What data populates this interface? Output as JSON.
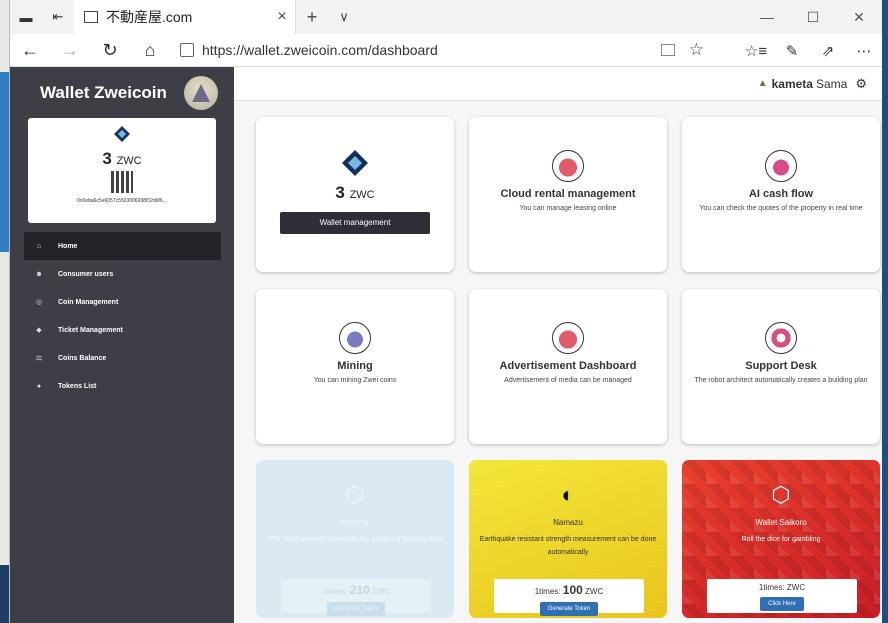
{
  "browser": {
    "tab_title": "不動産屋.com",
    "tab_close": "×",
    "new_tab": "+",
    "tab_list": "∨",
    "url": "https://wallet.zweicoin.com/dashboard",
    "back": "←",
    "forward": "→",
    "refresh": "↻",
    "home": "⌂",
    "favorite": "☆",
    "favorites_bar": "☆≡",
    "notes": "✎",
    "share": "⇗",
    "more": "⋯",
    "minimize": "—",
    "maximize": "☐",
    "close": "✕"
  },
  "sidebar": {
    "title": "Wallet Zweicoin",
    "wallet": {
      "amount": "3",
      "unit": "ZWC",
      "address": "0x0eba6c5e6057c5503006938f32d6f6..."
    },
    "items": [
      {
        "icon": "⌂",
        "icon_name": "home-icon",
        "label": "Home"
      },
      {
        "icon": "☻",
        "icon_name": "users-icon",
        "label": "Consumer users"
      },
      {
        "icon": "◎",
        "icon_name": "coin-icon",
        "label": "Coin Management"
      },
      {
        "icon": "◆",
        "icon_name": "ticket-icon",
        "label": "Ticket Management"
      },
      {
        "icon": "⚖",
        "icon_name": "balance-icon",
        "label": "Coins Balance"
      },
      {
        "icon": "●",
        "icon_name": "token-icon",
        "label": "Tokens List"
      }
    ]
  },
  "topbar": {
    "user_name": "kameta",
    "user_suffix": "Sama"
  },
  "cards": {
    "wallet": {
      "amount": "3",
      "unit": "ZWC",
      "button": "Wallet management"
    },
    "cloud": {
      "name": "Cloud rental management",
      "desc": "You can manage leasing online"
    },
    "ai": {
      "name": "AI cash flow",
      "desc": "You can check the quotes of the property in real time"
    },
    "mining": {
      "name": "Mining",
      "desc": "You can mining Zwei coins"
    },
    "ads": {
      "name": "Advertisement Dashboard",
      "desc": "Advertisement of media can be managed"
    },
    "support": {
      "name": "Support Desk",
      "desc": "The robot architect automatically creates a building plan"
    }
  },
  "promos": {
    "adnomi": {
      "name": "Adnomi",
      "desc": "The robot architect automatically creates a building plan",
      "times": "1times:",
      "price": "210",
      "unit": "ZWC",
      "button": "Generate Token"
    },
    "namazu": {
      "name": "Namazu",
      "desc": "Earthquake resistant strength measurement can be done automatically",
      "times": "1times:",
      "price": "100",
      "unit": "ZWC",
      "button": "Generate Token"
    },
    "saikoro": {
      "name": "Wallet Saikoro",
      "desc": "Roll the dice for gambling",
      "price_text": "1times: ZWC",
      "button": "Click Here"
    }
  }
}
